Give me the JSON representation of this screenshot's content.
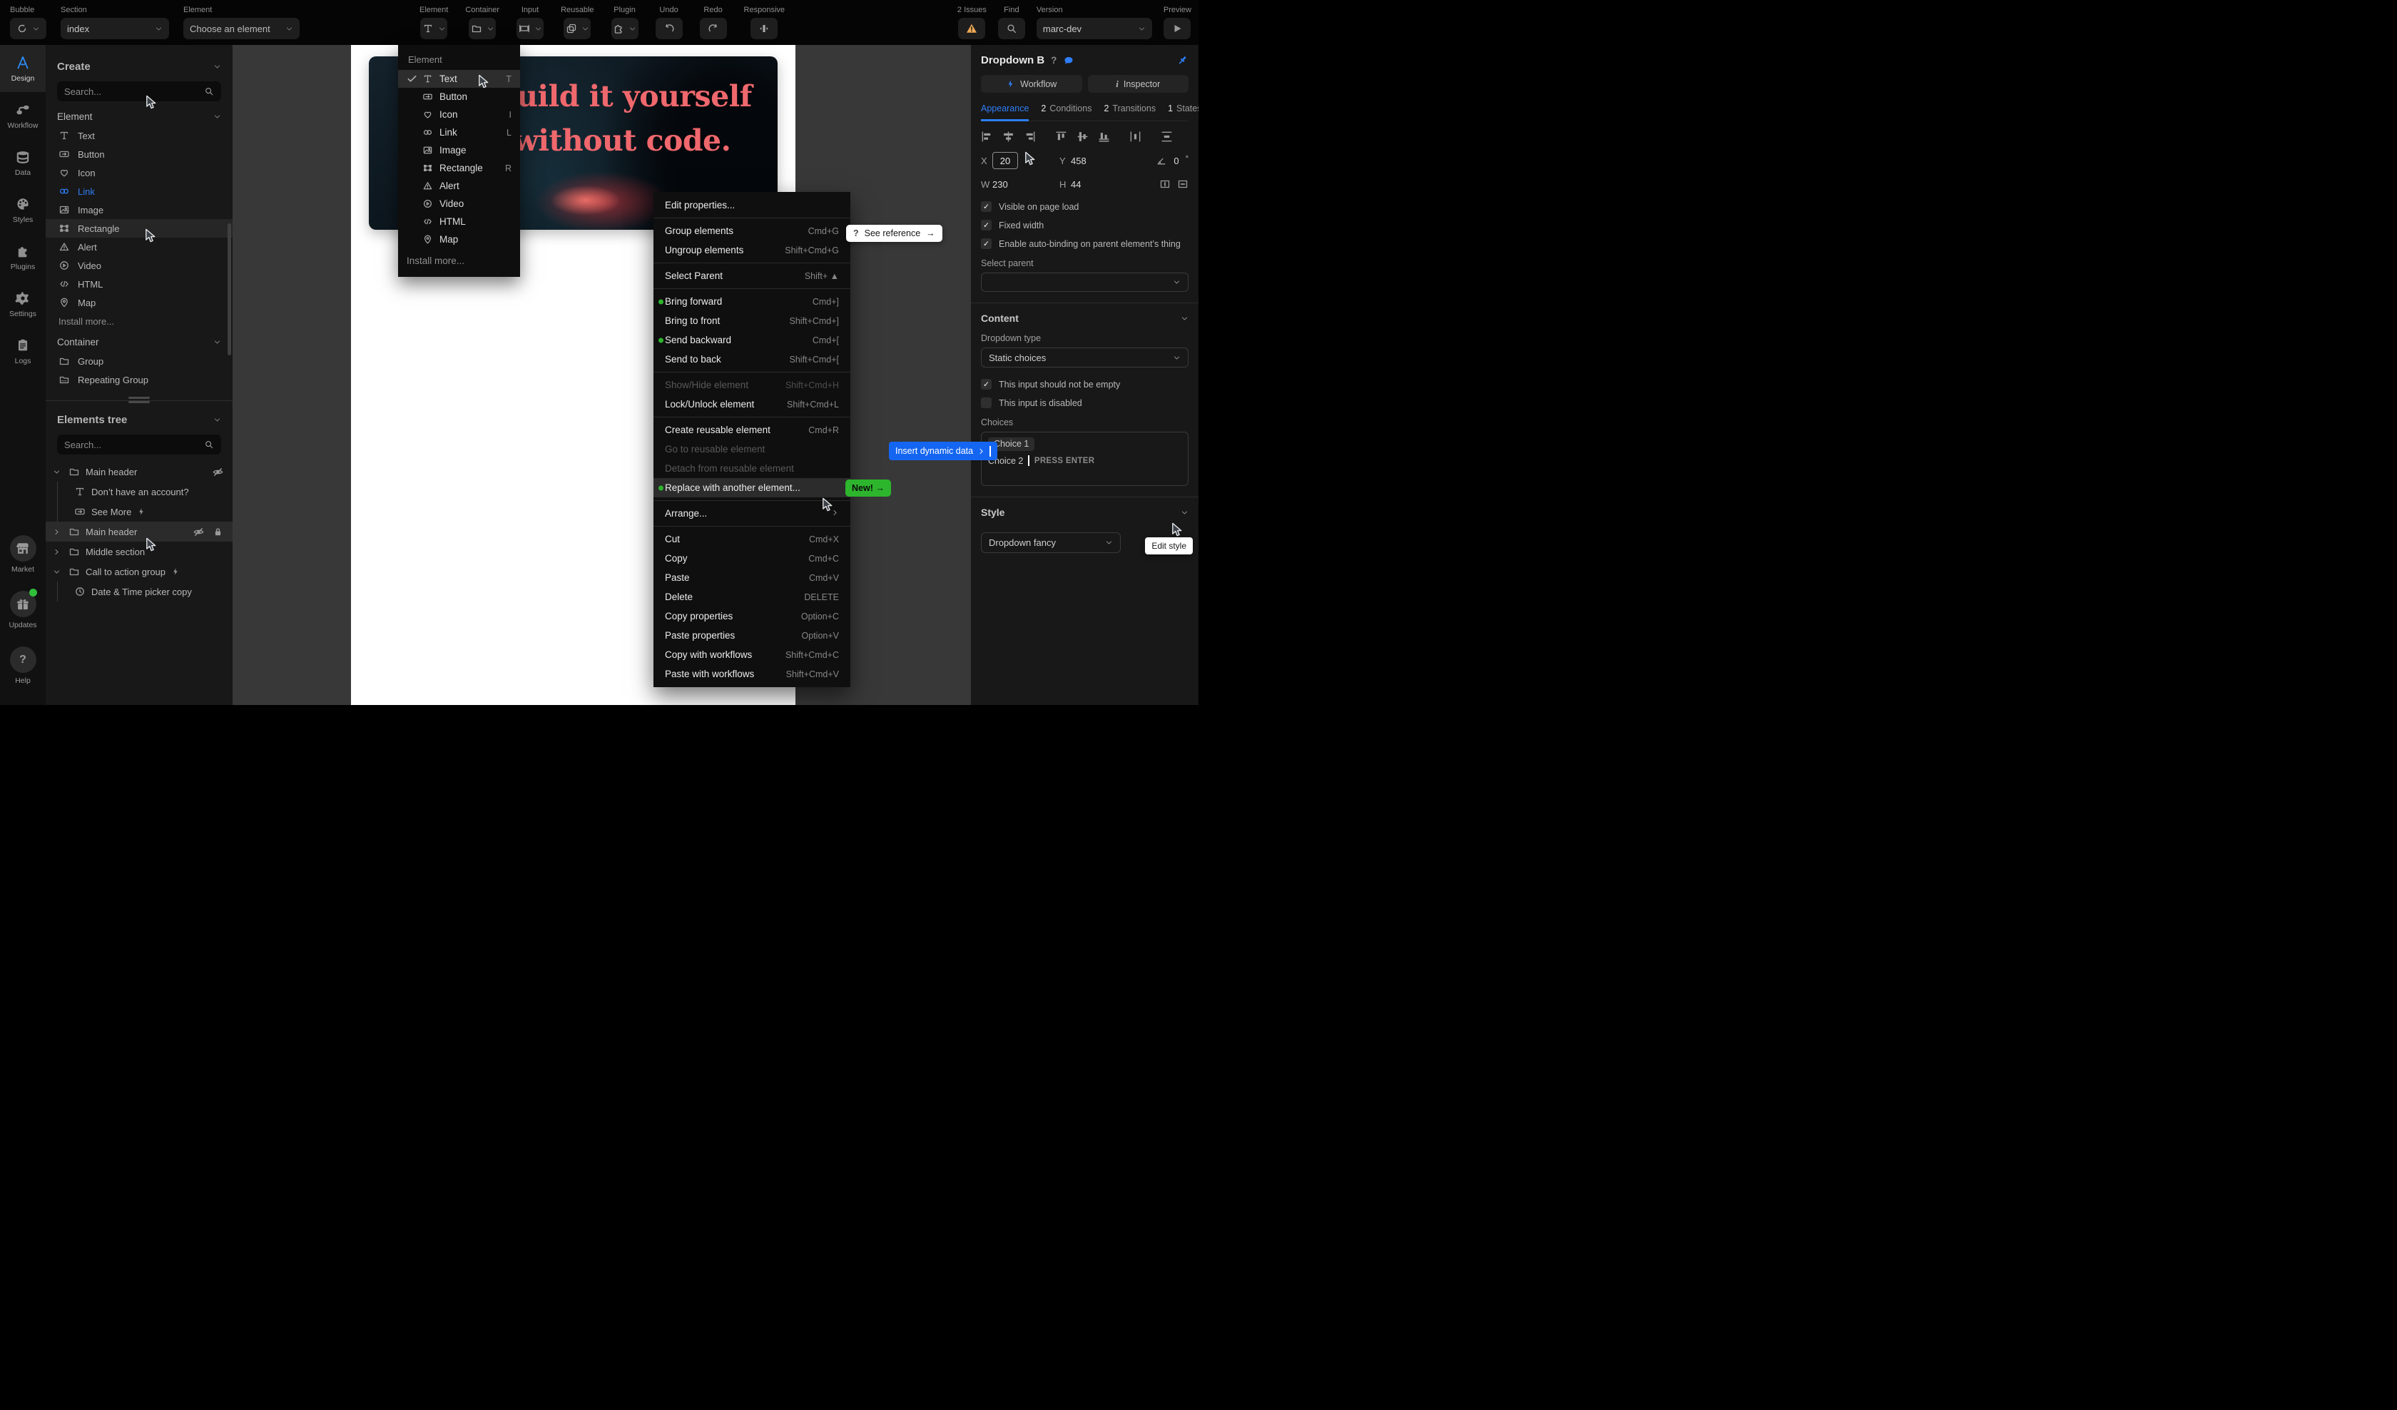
{
  "colors": {
    "accent_blue": "#2e7ef7",
    "green": "#2db52d",
    "orange": "#f0a954",
    "coral": "#ef686d",
    "dynamic_blue": "#1466f2"
  },
  "topbar": {
    "bubble_label": "Bubble",
    "section_label": "Section",
    "section_value": "index",
    "element_label": "Element",
    "element_value": "Choose an element",
    "tools": [
      {
        "label": "Element",
        "icon": "text",
        "chevron": true
      },
      {
        "label": "Container",
        "icon": "folder",
        "chevron": true
      },
      {
        "label": "Input",
        "icon": "input",
        "chevron": true
      },
      {
        "label": "Reusable",
        "icon": "reusable",
        "chevron": true
      },
      {
        "label": "Plugin",
        "icon": "plugin",
        "chevron": true
      },
      {
        "label": "Undo",
        "icon": "undo",
        "chevron": false
      },
      {
        "label": "Redo",
        "icon": "redo",
        "chevron": false
      },
      {
        "label": "Responsive",
        "icon": "responsive",
        "chevron": false
      }
    ],
    "issues_label": "2 Issues",
    "find_label": "Find",
    "version_label": "Version",
    "version_value": "marc-dev",
    "preview_label": "Preview"
  },
  "sidebar": {
    "items": [
      {
        "label": "Design",
        "icon": "design",
        "active": true
      },
      {
        "label": "Workflow",
        "icon": "workflow"
      },
      {
        "label": "Data",
        "icon": "data"
      },
      {
        "label": "Styles",
        "icon": "styles"
      },
      {
        "label": "Plugins",
        "icon": "plugins"
      },
      {
        "label": "Settings",
        "icon": "settings"
      },
      {
        "label": "Logs",
        "icon": "logs"
      }
    ],
    "bottom": [
      {
        "label": "Market",
        "icon": "market"
      },
      {
        "label": "Updates",
        "icon": "updates",
        "dot": true
      },
      {
        "label": "Help",
        "icon": "help"
      }
    ]
  },
  "left_panel": {
    "create_title": "Create",
    "search_placeholder": "Search...",
    "element_title": "Element",
    "element_items": [
      {
        "label": "Text",
        "icon": "text"
      },
      {
        "label": "Button",
        "icon": "button"
      },
      {
        "label": "Icon",
        "icon": "heart"
      },
      {
        "label": "Link",
        "icon": "link",
        "accent": true
      },
      {
        "label": "Image",
        "icon": "image"
      },
      {
        "label": "Rectangle",
        "icon": "rectangle",
        "highlight": true
      },
      {
        "label": "Alert",
        "icon": "alert"
      },
      {
        "label": "Video",
        "icon": "video"
      },
      {
        "label": "HTML",
        "icon": "html"
      },
      {
        "label": "Map",
        "icon": "map"
      }
    ],
    "install_more": "Install more...",
    "container_title": "Container",
    "container_items": [
      {
        "label": "Group",
        "icon": "folder"
      },
      {
        "label": "Repeating Group",
        "icon": "repeating"
      }
    ],
    "tree_title": "Elements tree",
    "tree_search_placeholder": "Search...",
    "tree_items": [
      {
        "label": "Main header",
        "icon": "folder",
        "expand": "open",
        "right": [
          "eyeslash-blue"
        ]
      },
      {
        "label": "Don’t have an account?",
        "icon": "text",
        "child": true,
        "guide": true
      },
      {
        "label": "See More",
        "icon": "button",
        "child": true,
        "guide": true,
        "bolt": true
      },
      {
        "label": "Main header",
        "icon": "folder",
        "expand": "closed",
        "highlight": true,
        "right": [
          "eyeslash",
          "lock"
        ]
      },
      {
        "label": "Middle section",
        "icon": "folder",
        "expand": "closed"
      },
      {
        "label": "Call to action group",
        "icon": "folder",
        "expand": "open",
        "bolt": true
      },
      {
        "label": "Date & Time picker copy",
        "icon": "clock",
        "child": true,
        "guide": true
      }
    ]
  },
  "canvas": {
    "headline": "Build it yourself\nwithout code."
  },
  "element_menu": {
    "title": "Element",
    "items": [
      {
        "label": "Text",
        "icon": "text",
        "shortcut": "T",
        "checked": true,
        "highlight": true
      },
      {
        "label": "Button",
        "icon": "button"
      },
      {
        "label": "Icon",
        "icon": "heart",
        "shortcut": "I"
      },
      {
        "label": "Link",
        "icon": "link",
        "shortcut": "L"
      },
      {
        "label": "Image",
        "icon": "image"
      },
      {
        "label": "Rectangle",
        "icon": "rectangle",
        "shortcut": "R"
      },
      {
        "label": "Alert",
        "icon": "alert"
      },
      {
        "label": "Video",
        "icon": "video"
      },
      {
        "label": "HTML",
        "icon": "html"
      },
      {
        "label": "Map",
        "icon": "map"
      }
    ],
    "footer": "Install more..."
  },
  "see_reference": {
    "q": "?",
    "label": "See reference",
    "arrow": "→"
  },
  "insert_dynamic": {
    "label": "Insert dynamic data"
  },
  "context_menu": {
    "groups": [
      [
        {
          "label": "Edit properties..."
        }
      ],
      [
        {
          "label": "Group elements",
          "shortcut": "Cmd+G"
        },
        {
          "label": "Ungroup elements",
          "shortcut": "Shift+Cmd+G"
        }
      ],
      [
        {
          "label": "Select Parent",
          "shortcut": "Shift+ ▲"
        }
      ],
      [
        {
          "label": "Bring forward",
          "shortcut": "Cmd+]",
          "dot": true
        },
        {
          "label": "Bring to front",
          "shortcut": "Shift+Cmd+]"
        },
        {
          "label": "Send backward",
          "shortcut": "Cmd+[",
          "dot": true
        },
        {
          "label": "Send to back",
          "shortcut": "Shift+Cmd+["
        }
      ],
      [
        {
          "label": "Show/Hide element",
          "shortcut": "Shift+Cmd+H",
          "disabled": true
        },
        {
          "label": "Lock/Unlock element",
          "shortcut": "Shift+Cmd+L"
        }
      ],
      [
        {
          "label": "Create reusable element",
          "shortcut": "Cmd+R"
        },
        {
          "label": "Go to reusable element",
          "disabled": true
        },
        {
          "label": "Detach from reusable element",
          "disabled": true
        },
        {
          "label": "Replace with another element...",
          "dot": true,
          "highlight": true,
          "badge": "New! →"
        }
      ],
      [
        {
          "label": "Arrange...",
          "submenu": true
        }
      ],
      [
        {
          "label": "Cut",
          "shortcut": "Cmd+X"
        },
        {
          "label": "Copy",
          "shortcut": "Cmd+C"
        },
        {
          "label": "Paste",
          "shortcut": "Cmd+V"
        },
        {
          "label": "Delete",
          "shortcut": "DELETE"
        },
        {
          "label": "Copy properties",
          "shortcut": "Option+C"
        },
        {
          "label": "Paste properties",
          "shortcut": "Option+V"
        },
        {
          "label": "Copy with workflows",
          "shortcut": "Shift+Cmd+C"
        },
        {
          "label": "Paste with workflows",
          "shortcut": "Shift+Cmd+V"
        }
      ]
    ]
  },
  "inspector": {
    "title": "Dropdown B",
    "help": "?",
    "workflow_btn": "Workflow",
    "inspector_btn": "Inspector",
    "tabs": [
      {
        "num": "",
        "label": "Appearance",
        "active": true
      },
      {
        "num": "2",
        "label": "Conditions"
      },
      {
        "num": "2",
        "label": "Transitions"
      },
      {
        "num": "1",
        "label": "States"
      }
    ],
    "x_label": "X",
    "x_value": "20",
    "y_label": "Y",
    "y_value": "458",
    "angle_value": "0",
    "angle_unit": "°",
    "w_label": "W",
    "w_value": "230",
    "h_label": "H",
    "h_value": "44",
    "appearance_checks": [
      {
        "label": "Visible on page load",
        "checked": true
      },
      {
        "label": "Fixed width",
        "checked": true
      },
      {
        "label": "Enable auto-binding on parent element’s thing",
        "checked": true
      }
    ],
    "select_parent_label": "Select parent",
    "content_title": "Content",
    "dropdown_type_label": "Dropdown type",
    "dropdown_type_value": "Static choices",
    "content_checks": [
      {
        "label": "This input should not be empty",
        "checked": true
      },
      {
        "label": "This input is disabled",
        "checked": false
      }
    ],
    "choices_label": "Choices",
    "choice1": "Choice 1",
    "choice2": "Choice 2",
    "press_enter": "PRESS ENTER",
    "style_title": "Style",
    "style_value": "Dropdown fancy",
    "tooltip": "Edit style"
  }
}
